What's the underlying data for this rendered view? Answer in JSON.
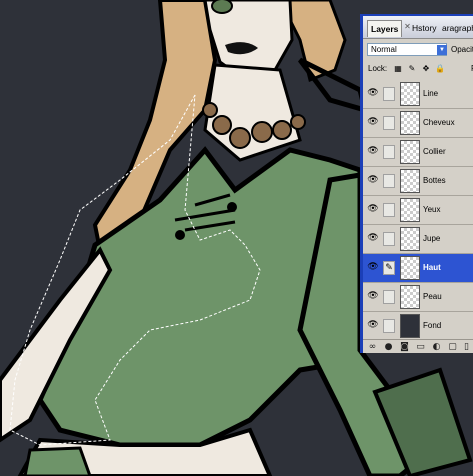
{
  "canvas": {
    "background": "#2e3139"
  },
  "panel": {
    "tabs": [
      {
        "label": "Layers",
        "active": true
      },
      {
        "label": "Hstory",
        "active": false
      },
      {
        "label": "aragraph",
        "active": false
      }
    ],
    "blend_mode": "Normal",
    "opacity_label": "Opacit",
    "lock_label": "Lock:",
    "fill_label": "F",
    "layers": [
      {
        "name": "Line",
        "visible": true,
        "selected": false
      },
      {
        "name": "Cheveux",
        "visible": true,
        "selected": false
      },
      {
        "name": "Collier",
        "visible": true,
        "selected": false
      },
      {
        "name": "Bottes",
        "visible": true,
        "selected": false
      },
      {
        "name": "Yeux",
        "visible": true,
        "selected": false
      },
      {
        "name": "Jupe",
        "visible": true,
        "selected": false
      },
      {
        "name": "Haut",
        "visible": true,
        "selected": true
      },
      {
        "name": "Peau",
        "visible": true,
        "selected": false
      },
      {
        "name": "Fond",
        "visible": true,
        "selected": false
      }
    ],
    "icons": {
      "eye": "👁",
      "brush": "✎",
      "lock_transparency": "▦",
      "lock_paint": "✎",
      "lock_move": "✥",
      "lock_all": "🔒",
      "tab_close": "✕",
      "dropdown": "▼"
    },
    "bottom_icons": [
      "link-icon",
      "fx-icon",
      "mask-icon",
      "folder-icon",
      "new-adjustment-icon",
      "new-layer-icon",
      "trash-icon"
    ],
    "selection_color": "#2d54d2",
    "border_color": "#1b3fb8"
  }
}
